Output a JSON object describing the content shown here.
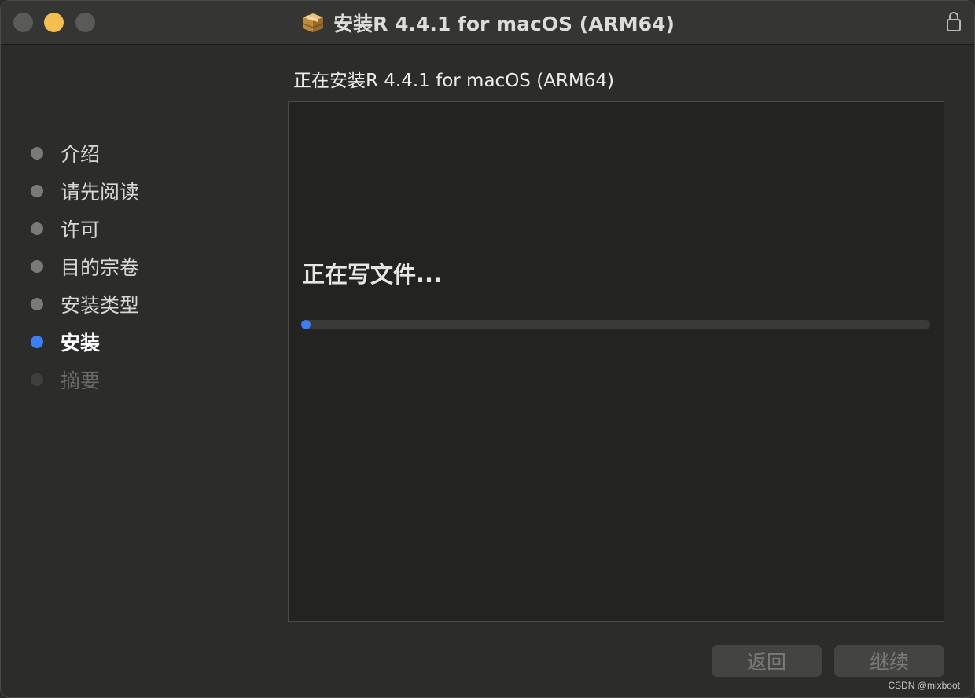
{
  "window": {
    "title": "安装R 4.4.1 for macOS (ARM64)",
    "icon": "package-icon",
    "lock_icon": "lock-icon"
  },
  "heading": "正在安装R 4.4.1 for macOS (ARM64)",
  "steps": [
    {
      "label": "介绍",
      "state": "done"
    },
    {
      "label": "请先阅读",
      "state": "done"
    },
    {
      "label": "许可",
      "state": "done"
    },
    {
      "label": "目的宗卷",
      "state": "done"
    },
    {
      "label": "安装类型",
      "state": "done"
    },
    {
      "label": "安装",
      "state": "current"
    },
    {
      "label": "摘要",
      "state": "future"
    }
  ],
  "status": {
    "text": "正在写文件...",
    "progress_percent": 1
  },
  "buttons": {
    "back_label": "返回",
    "continue_label": "继续"
  },
  "watermark": "CSDN @mixboot",
  "colors": {
    "accent": "#3d7ef0",
    "minimize": "#f4bf4f"
  }
}
